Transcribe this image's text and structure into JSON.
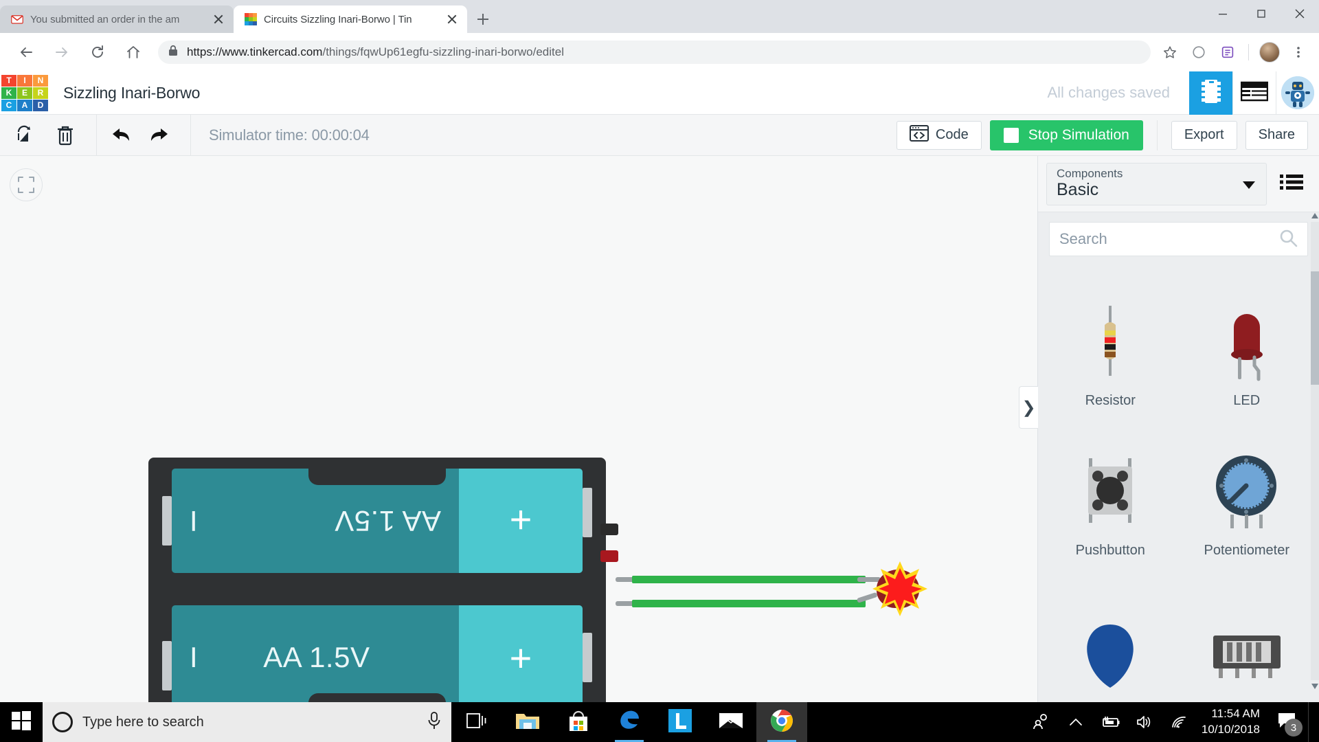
{
  "browser": {
    "tabs": [
      {
        "title": "You submitted an order in the am",
        "favicon": "gmail-icon",
        "active": false
      },
      {
        "title": "Circuits Sizzling Inari-Borwo | Tin",
        "favicon": "tinkercad-icon",
        "active": true
      }
    ],
    "new_tab_label": "+",
    "url_host": "https://www.tinkercad.com",
    "url_path": "/things/fqwUp61egfu-sizzling-inari-borwo/editel",
    "url_full": "https://www.tinkercad.com/things/fqwUp61egfu-sizzling-inari-borwo/editel",
    "icons": {
      "back": "back-arrow-icon",
      "forward": "forward-arrow-icon",
      "reload": "reload-icon",
      "home": "home-icon",
      "lock": "lock-icon",
      "bookmark": "star-icon",
      "extension": "circle-icon",
      "extension2": "puzzle-icon",
      "menu": "kebab-menu-icon"
    },
    "window_controls": {
      "minimize": "minimize-icon",
      "maximize": "maximize-icon",
      "close": "close-icon"
    }
  },
  "tinkercad": {
    "logo_letters": [
      "T",
      "I",
      "N",
      "K",
      "E",
      "R",
      "C",
      "A",
      "D"
    ],
    "logo_colors": [
      "#f4442e",
      "#f9773a",
      "#fb9a3c",
      "#2fb34a",
      "#8dc51e",
      "#c6d41b",
      "#1ba0e2",
      "#1e7fc9",
      "#2b5fa8"
    ],
    "design_title": "Sizzling Inari-Borwo",
    "save_status": "All changes saved",
    "header_buttons": [
      {
        "name": "circuit-view-button",
        "icon": "ic-chip-icon",
        "active": true
      },
      {
        "name": "components-list-button",
        "icon": "table-list-icon",
        "active": false
      }
    ],
    "avatar": "robot-avatar",
    "toolbar": {
      "rotate_label": "Rotate",
      "delete_label": "Delete",
      "undo_label": "Undo",
      "redo_label": "Redo",
      "sim_time_label": "Simulator time: 00:00:04",
      "code_label": "Code",
      "stop_label": "Stop Simulation",
      "export_label": "Export",
      "share_label": "Share"
    },
    "canvas": {
      "fit_view_label": "Fit view",
      "battery": {
        "cell_top_label": "AA 1.5V",
        "cell_bottom_label": "AA 1.5V",
        "plus_symbol": "+",
        "minus_symbol": "I"
      },
      "wire_color": "#2fb34a",
      "led_state": "exploded"
    },
    "panel": {
      "select_label": "Components",
      "select_value": "Basic",
      "list_view_icon": "list-view-icon",
      "search_placeholder": "Search",
      "search_value": "",
      "search_icon": "search-icon",
      "collapse_handle": "❯",
      "components": [
        {
          "name": "Resistor",
          "art": "resistor-art"
        },
        {
          "name": "LED",
          "art": "led-art"
        },
        {
          "name": "Pushbutton",
          "art": "pushbutton-art"
        },
        {
          "name": "Potentiometer",
          "art": "potentiometer-art"
        },
        {
          "name": "",
          "art": "capacitor-art"
        },
        {
          "name": "",
          "art": "dip-switch-art"
        }
      ]
    }
  },
  "taskbar": {
    "start_label": "Start",
    "search_placeholder": "Type here to search",
    "search_value": "",
    "cortana_icon": "cortana-circle-icon",
    "mic_icon": "microphone-icon",
    "task_view_icon": "task-view-icon",
    "apps": [
      {
        "name": "File Explorer",
        "icon": "folder-icon",
        "running": false,
        "active": false
      },
      {
        "name": "Microsoft Store",
        "icon": "store-icon",
        "running": false,
        "active": false
      },
      {
        "name": "Microsoft Edge",
        "icon": "edge-icon",
        "running": true,
        "active": false
      },
      {
        "name": "L App",
        "icon": "letter-l-icon",
        "running": false,
        "active": false
      },
      {
        "name": "Mail",
        "icon": "mail-icon",
        "running": false,
        "active": false
      },
      {
        "name": "Google Chrome",
        "icon": "chrome-icon",
        "running": true,
        "active": true
      }
    ],
    "tray": {
      "people_icon": "people-icon",
      "show_hidden_icon": "chevron-up-icon",
      "battery_icon": "battery-charging-icon",
      "volume_icon": "speaker-icon",
      "network_icon": "wifi-icon",
      "time": "11:54 AM",
      "date": "10/10/2018",
      "notifications_icon": "action-center-icon",
      "notifications_count": "3"
    }
  }
}
